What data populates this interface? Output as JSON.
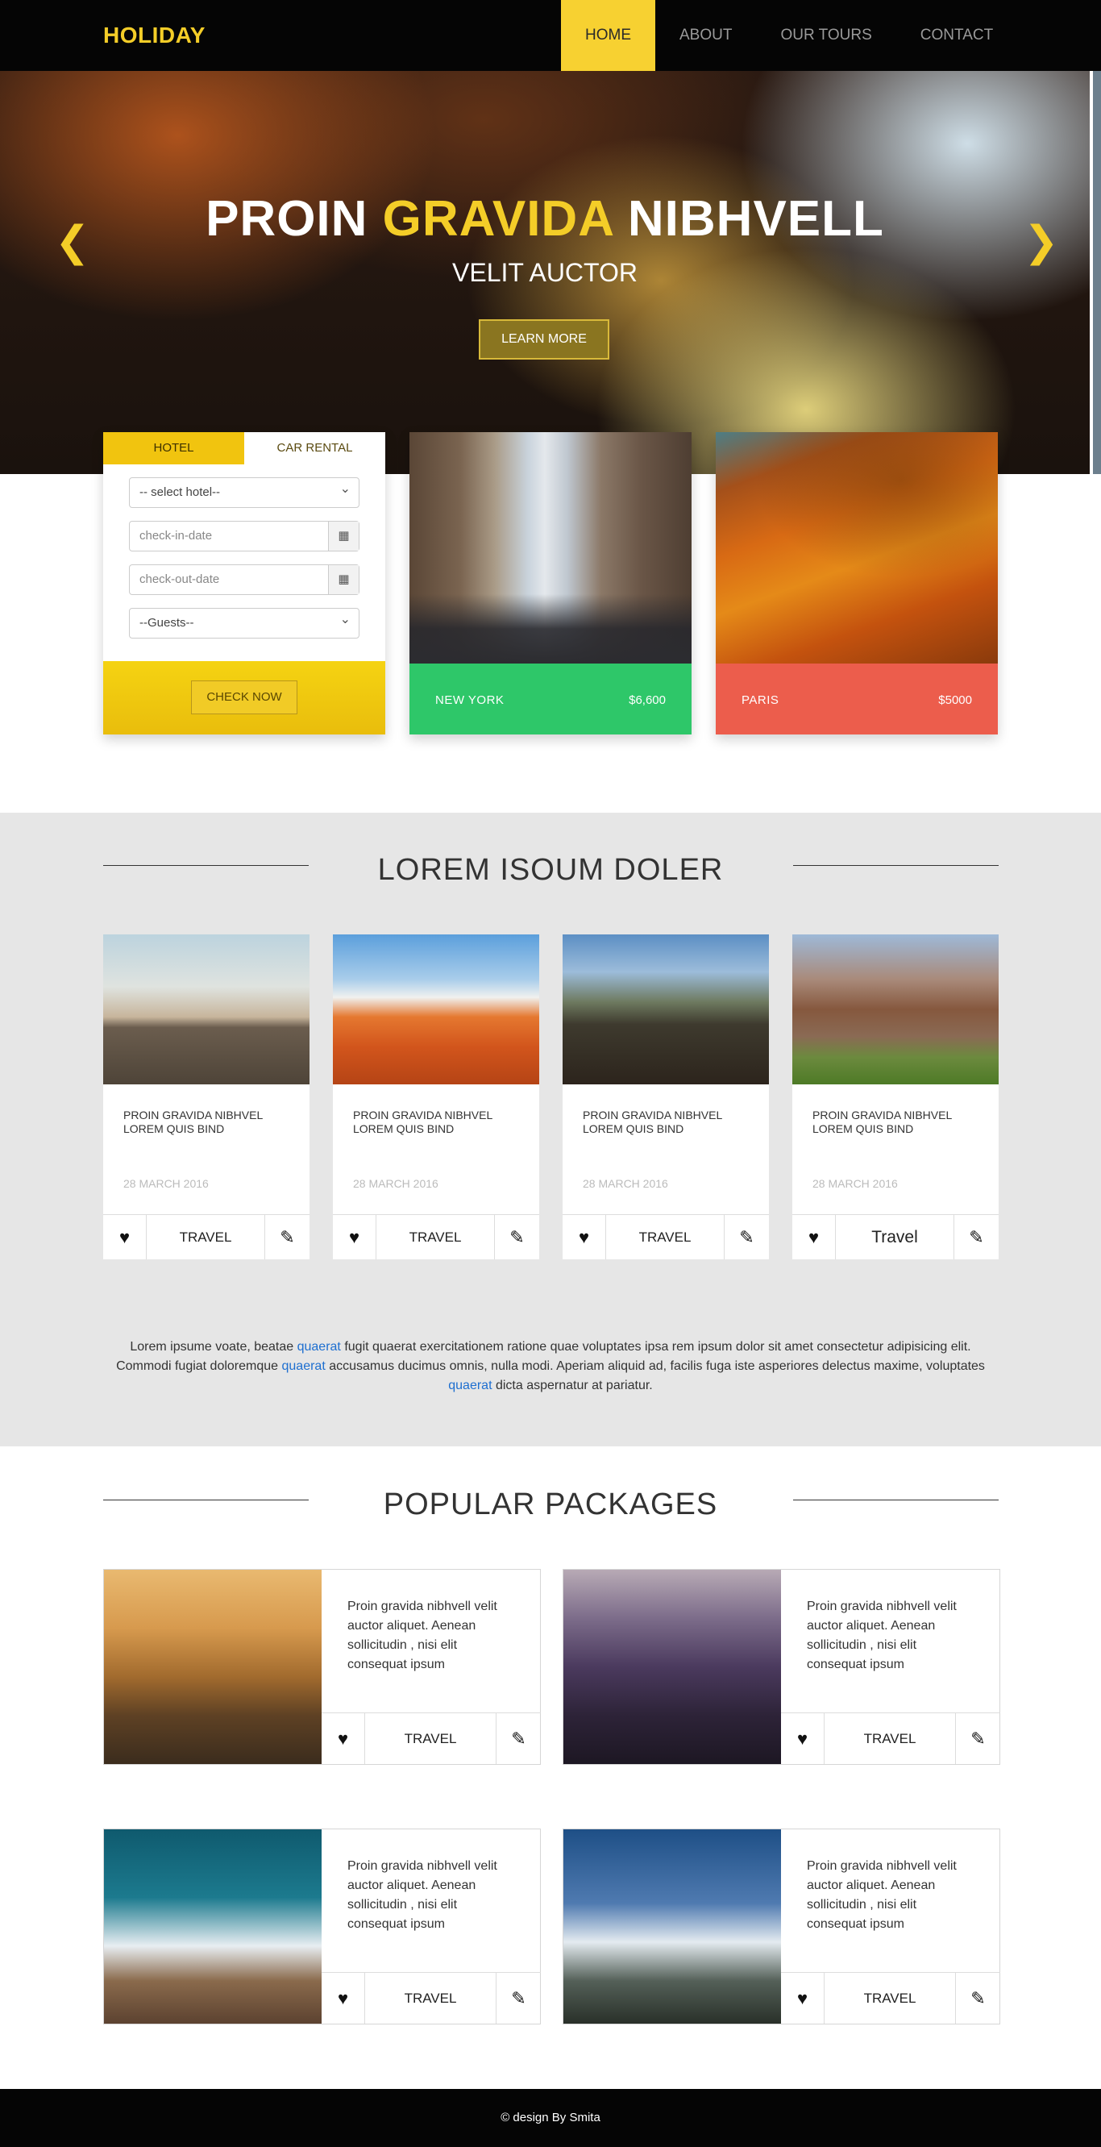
{
  "nav": {
    "logo": "HOLIDAY",
    "items": [
      {
        "label": "HOME"
      },
      {
        "label": "ABOUT"
      },
      {
        "label": "OUR TOURS"
      },
      {
        "label": "CONTACT"
      }
    ]
  },
  "hero": {
    "title_part1": "PROIN ",
    "title_highlight": "GRAVIDA",
    "title_part2": " NIBHVELL",
    "subtitle": "VELIT AUCTOR",
    "button": "LEARN MORE",
    "prev_arrow": "❮",
    "next_arrow": "❯"
  },
  "booking": {
    "tabs": [
      {
        "label": "HOTEL"
      },
      {
        "label": "CAR RENTAL"
      }
    ],
    "hotel_select": "-- select hotel--",
    "checkin_placeholder": "check-in-date",
    "checkout_placeholder": "check-out-date",
    "guests_select": "--Guests--",
    "check_button": "CHECK NOW"
  },
  "destinations": [
    {
      "name": "NEW YORK",
      "price": "$6,600",
      "color": "#2ec769"
    },
    {
      "name": "PARIS",
      "price": "$5000",
      "color": "#ec5d4c"
    }
  ],
  "lorem_section": {
    "title": "LOREM ISOUM DOLER",
    "cards": [
      {
        "text": "PROIN GRAVIDA NIBHVEL LOREM QUIS BIND",
        "date": "28 MARCH 2016",
        "action": "TRAVEL"
      },
      {
        "text": "PROIN GRAVIDA NIBHVEL LOREM QUIS BIND",
        "date": "28 MARCH 2016",
        "action": "TRAVEL"
      },
      {
        "text": "PROIN GRAVIDA NIBHVEL LOREM QUIS BIND",
        "date": "28 MARCH 2016",
        "action": "TRAVEL"
      },
      {
        "text": "PROIN GRAVIDA NIBHVEL LOREM QUIS BIND",
        "date": "28 MARCH 2016",
        "action": "Travel"
      }
    ],
    "paragraph": {
      "t1": "Lorem ipsume voate, beatae ",
      "link": "quaerat",
      "t2": " fugit quaerat exercitationem ratione quae voluptates ipsa rem ipsum dolor sit amet consectetur adipisicing elit. Commodi fugiat doloremque ",
      "t3": " accusamus ducimus omnis, nulla modi. Aperiam aliquid ad, facilis fuga iste asperiores delectus maxime, voluptates ",
      "t4": " dicta aspernatur at pariatur."
    }
  },
  "packages": {
    "title": "POPULAR PACKAGES",
    "items": [
      {
        "text": "Proin gravida nibhvell velit auctor aliquet. Aenean sollicitudin , nisi elit consequat ipsum",
        "action": "TRAVEL"
      },
      {
        "text": "Proin gravida nibhvell velit auctor aliquet. Aenean sollicitudin , nisi elit consequat ipsum",
        "action": "TRAVEL"
      },
      {
        "text": "Proin gravida nibhvell velit auctor aliquet. Aenean sollicitudin , nisi elit consequat ipsum",
        "action": "TRAVEL"
      },
      {
        "text": "Proin gravida nibhvell velit auctor aliquet. Aenean sollicitudin , nisi elit consequat ipsum",
        "action": "TRAVEL"
      }
    ]
  },
  "footer": {
    "text": "© design By Smita"
  },
  "colors": {
    "accent": "#f4cd28",
    "nav_bg": "#050505",
    "section_gray": "#e6e6e6",
    "link": "#1e6fd0"
  }
}
